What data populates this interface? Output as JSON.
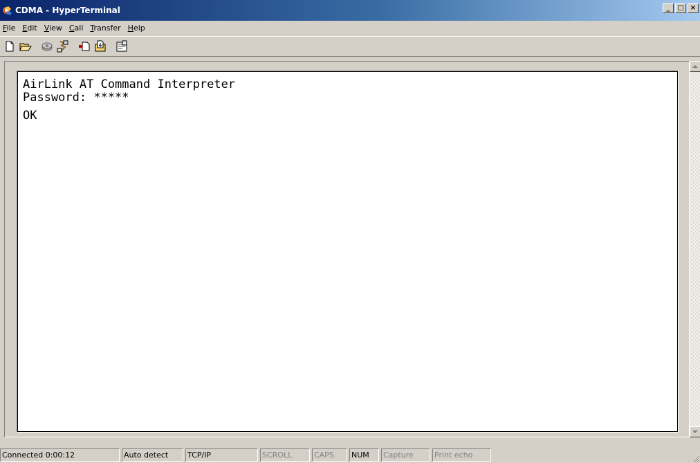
{
  "window": {
    "title": "CDMA - HyperTerminal",
    "controls": {
      "minimize": "_",
      "maximize": "□",
      "close": "×"
    }
  },
  "menu": [
    {
      "label": "File",
      "accel": "F"
    },
    {
      "label": "Edit",
      "accel": "E"
    },
    {
      "label": "View",
      "accel": "V"
    },
    {
      "label": "Call",
      "accel": "C"
    },
    {
      "label": "Transfer",
      "accel": "T"
    },
    {
      "label": "Help",
      "accel": "H"
    }
  ],
  "toolbar": {
    "buttons": [
      {
        "icon": "new-icon"
      },
      {
        "icon": "open-icon"
      },
      {
        "icon": "connect-icon"
      },
      {
        "icon": "disconnect-icon"
      },
      {
        "icon": "send-icon"
      },
      {
        "icon": "receive-icon"
      },
      {
        "icon": "properties-icon"
      }
    ]
  },
  "terminal": {
    "lines": [
      "AirLink AT Command Interpreter",
      "Password: *****",
      "",
      "OK"
    ]
  },
  "status": {
    "connection": "Connected 0:00:12",
    "detect": "Auto detect",
    "protocol": "TCP/IP",
    "scroll": "SCROLL",
    "caps": "CAPS",
    "num": "NUM",
    "capture": "Capture",
    "print_echo": "Print echo"
  },
  "colors": {
    "titlebar_start": "#0a246a",
    "titlebar_end": "#a6caf0",
    "face": "#d4d0c8",
    "terminal_bg": "#ffffff",
    "inactive_text": "#808080"
  }
}
